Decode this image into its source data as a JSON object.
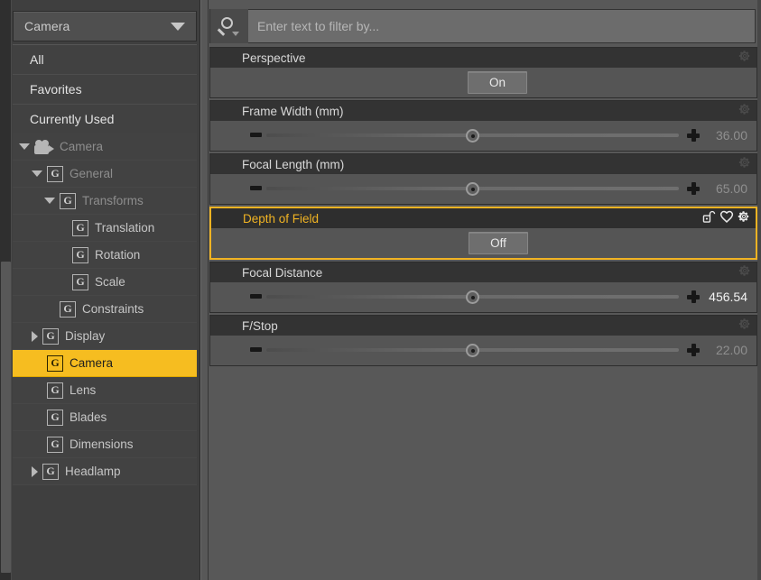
{
  "sidebar": {
    "dropdown": {
      "value": "Camera",
      "icon": "chevron-down-icon"
    },
    "top_items": [
      {
        "label": "All"
      },
      {
        "label": "Favorites"
      },
      {
        "label": "Currently Used"
      }
    ],
    "tree": [
      {
        "label": "Camera",
        "indent": 0,
        "twisty": "down",
        "icon": "camcorder-icon",
        "selected": false,
        "tone": "dim"
      },
      {
        "label": "General",
        "indent": 1,
        "twisty": "down",
        "icon": "g-badge-icon",
        "selected": false,
        "tone": "dim"
      },
      {
        "label": "Transforms",
        "indent": 2,
        "twisty": "down",
        "icon": "g-badge-icon",
        "selected": false,
        "tone": "dim"
      },
      {
        "label": "Translation",
        "indent": 3,
        "twisty": "none",
        "icon": "g-badge-icon",
        "selected": false,
        "tone": "bright"
      },
      {
        "label": "Rotation",
        "indent": 3,
        "twisty": "none",
        "icon": "g-badge-icon",
        "selected": false,
        "tone": "bright"
      },
      {
        "label": "Scale",
        "indent": 3,
        "twisty": "none",
        "icon": "g-badge-icon",
        "selected": false,
        "tone": "bright"
      },
      {
        "label": "Constraints",
        "indent": 2,
        "twisty": "none",
        "icon": "g-badge-icon",
        "selected": false,
        "tone": "bright"
      },
      {
        "label": "Display",
        "indent": 1,
        "twisty": "right",
        "icon": "g-badge-icon",
        "selected": false,
        "tone": "bright"
      },
      {
        "label": "Camera",
        "indent": 1,
        "twisty": "none",
        "icon": "g-badge-icon",
        "selected": true,
        "tone": "bright"
      },
      {
        "label": "Lens",
        "indent": 1,
        "twisty": "none",
        "icon": "g-badge-icon",
        "selected": false,
        "tone": "bright"
      },
      {
        "label": "Blades",
        "indent": 1,
        "twisty": "none",
        "icon": "g-badge-icon",
        "selected": false,
        "tone": "bright"
      },
      {
        "label": "Dimensions",
        "indent": 1,
        "twisty": "none",
        "icon": "g-badge-icon",
        "selected": false,
        "tone": "bright"
      },
      {
        "label": "Headlamp",
        "indent": 1,
        "twisty": "right",
        "icon": "g-badge-icon",
        "selected": false,
        "tone": "bright"
      }
    ]
  },
  "search": {
    "placeholder": "Enter text to filter by...",
    "value": "",
    "icon": "magnifier-icon"
  },
  "properties": [
    {
      "name": "Perspective",
      "kind": "toggle",
      "toggle_label": "On",
      "highlight": false,
      "icons": [
        "gear-icon"
      ]
    },
    {
      "name": "Frame Width (mm)",
      "kind": "slider",
      "value": "36.00",
      "handle_pct": 50,
      "value_bright": false,
      "highlight": false,
      "icons": [
        "gear-icon"
      ]
    },
    {
      "name": "Focal Length (mm)",
      "kind": "slider",
      "value": "65.00",
      "handle_pct": 50,
      "value_bright": false,
      "highlight": false,
      "icons": [
        "gear-icon"
      ]
    },
    {
      "name": "Depth of Field",
      "kind": "toggle",
      "toggle_label": "Off",
      "highlight": true,
      "icons": [
        "unlock-icon",
        "heart-icon",
        "gear-icon"
      ]
    },
    {
      "name": "Focal Distance",
      "kind": "slider",
      "value": "456.54",
      "handle_pct": 50,
      "value_bright": true,
      "highlight": false,
      "icons": [
        "gear-icon"
      ]
    },
    {
      "name": "F/Stop",
      "kind": "slider",
      "value": "22.00",
      "handle_pct": 50,
      "value_bright": false,
      "highlight": false,
      "icons": [
        "gear-icon"
      ]
    }
  ],
  "colors": {
    "accent": "#f6bd20",
    "highlight_border": "#f0b323",
    "panel_bg": "#585858",
    "sidebar_bg": "#3f3f3f",
    "header_bg": "#333333"
  }
}
